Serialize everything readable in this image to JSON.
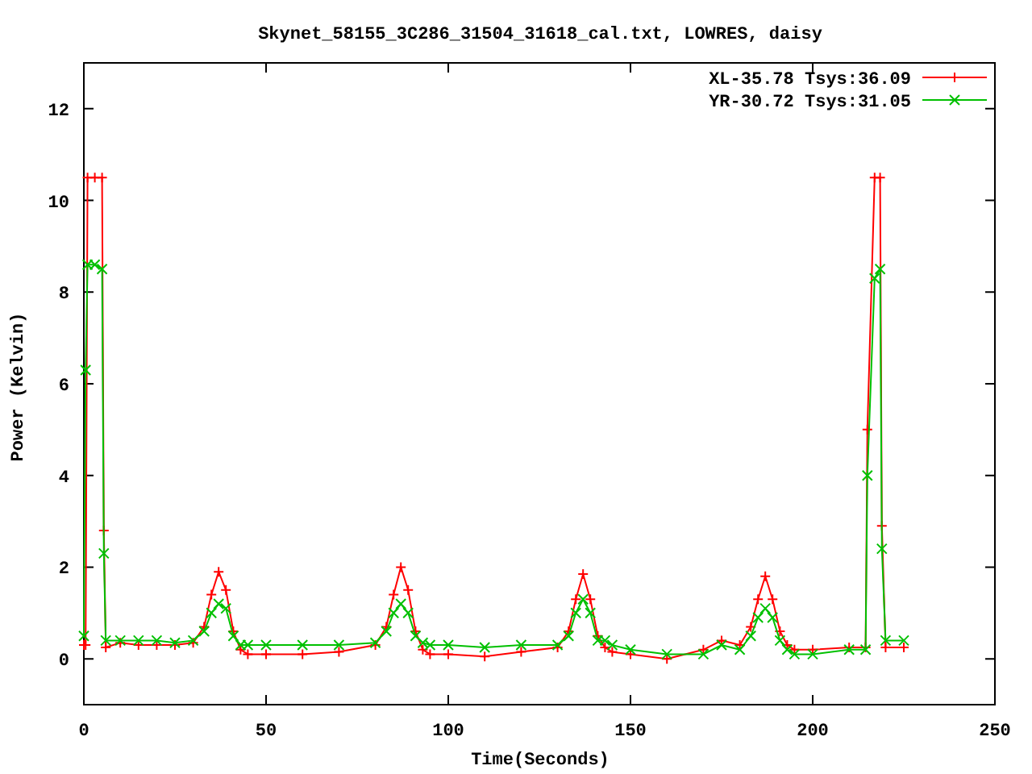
{
  "plot": {
    "chart_data": {
      "type": "line",
      "title": "Skynet_58155_3C286_31504_31618_cal.txt, LOWRES, daisy",
      "xlabel": "Time(Seconds)",
      "ylabel": "Power (Kelvin)",
      "xlim": [
        0,
        250
      ],
      "ylim": [
        -1,
        13
      ],
      "legend": true,
      "xticks": [
        0,
        50,
        100,
        150,
        200,
        250
      ],
      "yticks": [
        0,
        2,
        4,
        6,
        8,
        10,
        12
      ],
      "x": [
        0,
        0.5,
        1,
        3,
        5,
        5.5,
        6,
        10,
        15,
        20,
        25,
        30,
        33,
        35,
        37,
        39,
        41,
        43,
        45,
        50,
        60,
        70,
        80,
        83,
        85,
        87,
        89,
        91,
        93,
        95,
        100,
        110,
        120,
        130,
        133,
        135,
        137,
        139,
        141,
        143,
        145,
        150,
        160,
        170,
        175,
        180,
        183,
        185,
        187,
        189,
        191,
        193,
        195,
        200,
        210,
        214.5,
        215,
        217,
        218.5,
        219,
        220,
        225
      ],
      "series": [
        {
          "name": "XL-35.78 Tsys:36.09",
          "color": "#ff0000",
          "marker": "plus",
          "values": [
            0.3,
            0.3,
            10.5,
            10.5,
            10.5,
            2.8,
            0.25,
            0.35,
            0.3,
            0.3,
            0.3,
            0.35,
            0.7,
            1.4,
            1.9,
            1.5,
            0.6,
            0.2,
            0.1,
            0.1,
            0.1,
            0.15,
            0.3,
            0.7,
            1.4,
            2.0,
            1.5,
            0.6,
            0.2,
            0.1,
            0.1,
            0.05,
            0.15,
            0.25,
            0.6,
            1.3,
            1.85,
            1.3,
            0.5,
            0.25,
            0.15,
            0.1,
            0.0,
            0.2,
            0.4,
            0.3,
            0.7,
            1.3,
            1.8,
            1.3,
            0.6,
            0.3,
            0.2,
            0.2,
            0.25,
            0.25,
            5.0,
            10.5,
            10.5,
            2.9,
            0.25,
            0.25
          ]
        },
        {
          "name": "YR-30.72 Tsys:31.05",
          "color": "#00c000",
          "marker": "cross",
          "values": [
            0.5,
            6.3,
            8.6,
            8.6,
            8.5,
            2.3,
            0.4,
            0.4,
            0.4,
            0.4,
            0.35,
            0.4,
            0.6,
            1.0,
            1.2,
            1.1,
            0.5,
            0.3,
            0.3,
            0.3,
            0.3,
            0.3,
            0.35,
            0.6,
            1.0,
            1.2,
            1.0,
            0.5,
            0.35,
            0.3,
            0.3,
            0.25,
            0.3,
            0.3,
            0.5,
            1.0,
            1.3,
            1.0,
            0.4,
            0.4,
            0.3,
            0.2,
            0.1,
            0.1,
            0.3,
            0.2,
            0.5,
            0.9,
            1.1,
            0.9,
            0.4,
            0.2,
            0.1,
            0.1,
            0.2,
            0.2,
            4.0,
            8.3,
            8.5,
            2.4,
            0.4,
            0.4
          ]
        }
      ]
    }
  }
}
